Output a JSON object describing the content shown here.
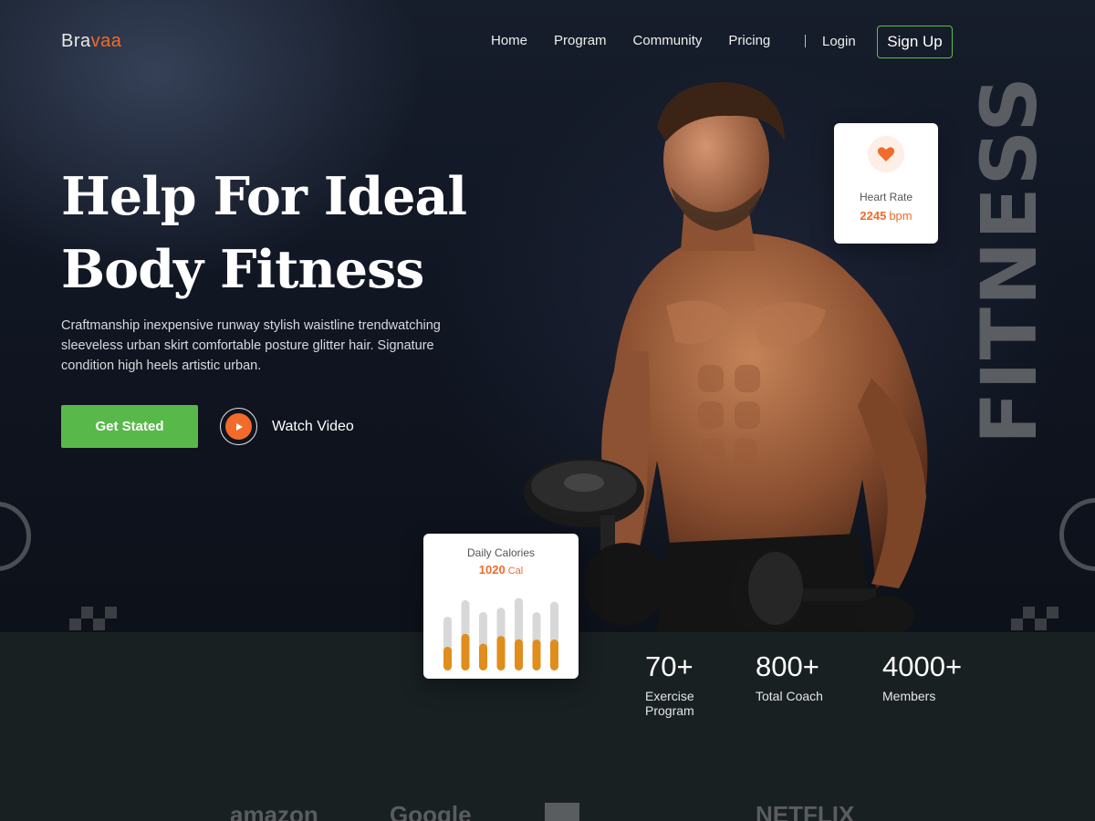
{
  "brand": {
    "part1": "Bra",
    "part2": "vaa",
    "accent": "#f26b2a"
  },
  "nav": {
    "items": [
      "Home",
      "Program",
      "Community",
      "Pricing"
    ],
    "login": "Login",
    "signup": "Sign Up"
  },
  "hero": {
    "title_line1": "Help For Ideal",
    "title_line2": "Body Fitness",
    "description": "Craftmanship inexpensive runway stylish waistline trendwatching sleeveless urban skirt comfortable posture glitter hair. Signature condition high heels artistic urban.",
    "cta": "Get Stated",
    "watch": "Watch Video",
    "side_word": "FITNESS"
  },
  "heart_rate": {
    "label": "Heart Rate",
    "value": "2245",
    "unit": "bpm",
    "icon": "heart-icon"
  },
  "calories": {
    "label": "Daily Calories",
    "value": "1020",
    "unit": "Cal",
    "bars": [
      {
        "total": 0.72,
        "fill": 0.44
      },
      {
        "total": 0.94,
        "fill": 0.52
      },
      {
        "total": 0.78,
        "fill": 0.46
      },
      {
        "total": 0.84,
        "fill": 0.55
      },
      {
        "total": 0.97,
        "fill": 0.43
      },
      {
        "total": 0.78,
        "fill": 0.53
      },
      {
        "total": 0.92,
        "fill": 0.45
      }
    ]
  },
  "stats": [
    {
      "number": "70+",
      "label": "Exercise Program"
    },
    {
      "number": "800+",
      "label": "Total Coach"
    },
    {
      "number": "4000+",
      "label": "Members"
    }
  ],
  "brands": [
    "amazon",
    "Google",
    "",
    "NETFLIX"
  ],
  "colors": {
    "green": "#58b84a",
    "orange": "#f26b2a",
    "bar_bg": "#d8d8d8",
    "bar_fill": "#e08d1b"
  }
}
